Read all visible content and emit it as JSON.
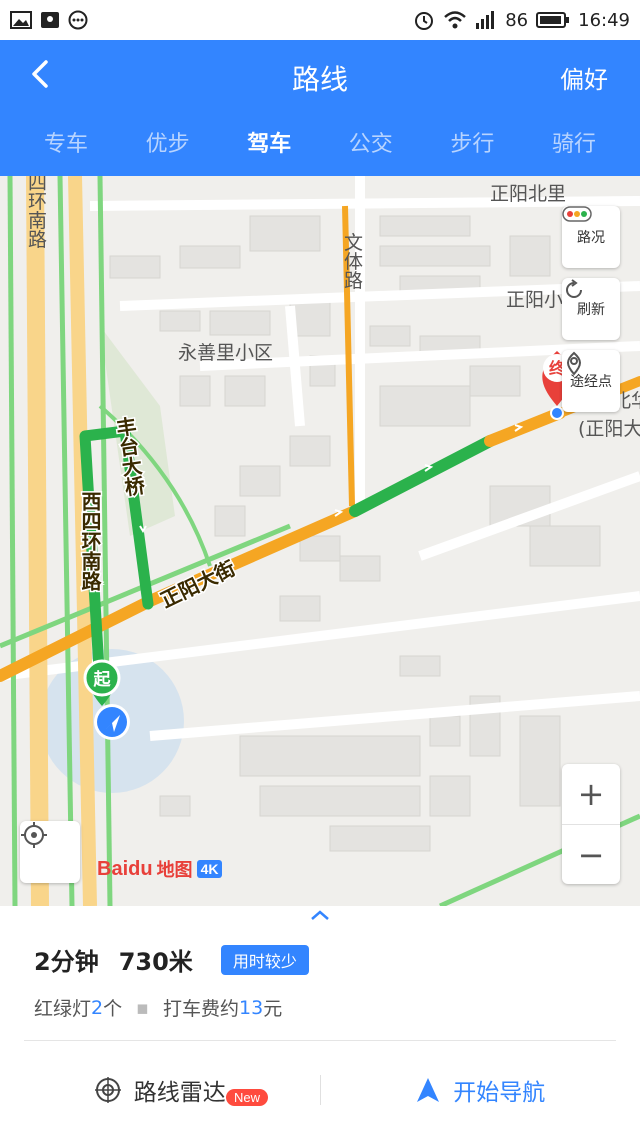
{
  "status_bar": {
    "signal": "86",
    "time": "16:49"
  },
  "header": {
    "title": "路线",
    "preference": "偏好"
  },
  "tabs": [
    {
      "label": "专车"
    },
    {
      "label": "优步"
    },
    {
      "label": "驾车"
    },
    {
      "label": "公交"
    },
    {
      "label": "步行"
    },
    {
      "label": "骑行"
    }
  ],
  "active_tab": "驾车",
  "map": {
    "labels": {
      "w4ring_top": "西四环南路",
      "w4ring_bottom": "西四环南路",
      "yongshanli": "永善里小区",
      "wentilu": "文体路",
      "zhengyang_beili": "正阳北里",
      "zhengyang_xiao": "正阳小",
      "zhengyang_dajie": "正阳大街",
      "fengtai_daqiao": "丰台大桥",
      "dest_name": "正阳北华联",
      "dest_sub": "(正阳大"
    },
    "buttons": {
      "traffic": "路况",
      "refresh": "刷新",
      "waypoint": "途经点"
    },
    "markers": {
      "start": "起",
      "end": "终"
    },
    "brand": {
      "baidu": "Baidu",
      "ditu": "地图",
      "quality": "4K"
    },
    "zoom": {
      "plus": "+",
      "minus": "−"
    }
  },
  "route": {
    "time": "2分钟",
    "distance": "730米",
    "badge": "用时较少",
    "traffic_light_label": "红绿灯",
    "traffic_light_count": "2",
    "traffic_light_unit": "个",
    "fare_label": "打车费约",
    "fare_value": "13",
    "fare_unit": "元"
  },
  "actions": {
    "radar": "路线雷达",
    "radar_badge": "New",
    "navigate": "开始导航"
  },
  "colors": {
    "brand_blue": "#3385ff",
    "traffic_green": "#2bb24c",
    "traffic_yellow": "#f5a623",
    "badge_red": "#ff4b3e"
  }
}
